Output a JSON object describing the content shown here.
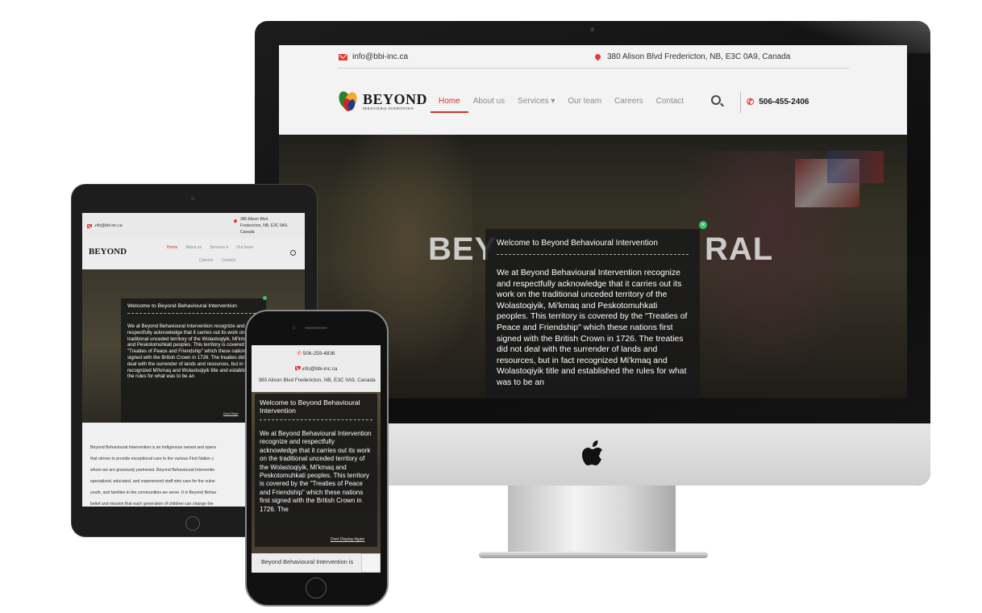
{
  "site": {
    "email": "info@bbi-inc.ca",
    "address": "380 Alison Blvd Fredericton, NB, E3C 0A9, Canada",
    "phone": "506-455-2406",
    "mobile_phone": "506-259-4836",
    "logo_name": "BEYOND",
    "logo_tagline": "BEHAVIOURAL INTERVENTION",
    "nav": [
      "Home",
      "About us",
      "Services",
      "Our team",
      "Careers",
      "Contact"
    ],
    "hero_title_left": "BEY",
    "hero_title_right": "RAL",
    "popup_title": "Welcome to Beyond Behavioural Intervention",
    "popup_body": "We at Beyond Behavioural Intervention recognize and respectfully acknowledge that it carries out its work on the traditional unceded territory of the Wolastoqiyik, Mi'kmaq and Peskotomuhkati peoples. This territory is covered by the \"Treaties of Peace and Friendship\" which these nations first signed with the British Crown in 1726. The treaties did not deal with the surrender of lands and resources, but in fact recognized Mi'kmaq and Wolastoqiyik title and established the rules for what was to be an",
    "popup_body_mobile": "We at Beyond Behavioural Intervention recognize and respectfully acknowledge that it carries out its work on the traditional unceded territory of the Wolastoqiyik, Mi'kmaq and Peskotomuhkati peoples. This territory is covered by the \"Treaties of Peace and Friendship\" which these nations first signed with the British Crown in 1726. The",
    "dont_display": "Dont Display Again",
    "tablet_dont_display": "Dont Displ",
    "tablet_addr_lines": [
      "380 Alison Blvd",
      "Fredericton, NB, E3C 0A9,",
      "Canada"
    ],
    "tablet_about": [
      "Beyond Behavioural Intervention is an Indigenous owned and opera",
      "that strives to provide exceptional care to the various First Nation c",
      "whom we are graciously partnered. Beyond Behavioural Interventio",
      "specialized, educated, and experienced staff who care for the vulne",
      "youth, and families in the communities we serve. It is Beyond Behav",
      "belief and mission that each generation of children can change the"
    ],
    "mobile_addr": "380 Alison Blvd Fredericton, NB, E3C 0A9, Canada",
    "mobile_footer": "Beyond Behavioural Intervention is"
  }
}
